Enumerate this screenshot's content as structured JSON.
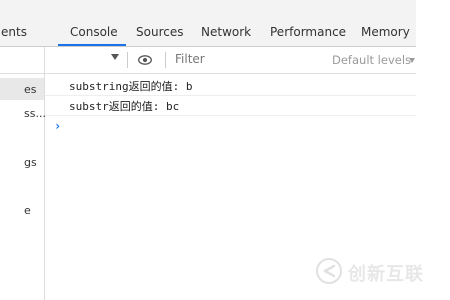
{
  "tabs": [
    {
      "label": "ents"
    },
    {
      "label": "Console"
    },
    {
      "label": "Sources"
    },
    {
      "label": "Network"
    },
    {
      "label": "Performance"
    },
    {
      "label": "Memory"
    }
  ],
  "active_tab": "Console",
  "toolbar": {
    "filter_placeholder": "Filter",
    "levels_label": "Default levels"
  },
  "sidebar": {
    "items": [
      {
        "label": "es"
      },
      {
        "label": "ss..."
      },
      {
        "label": "gs"
      },
      {
        "label": "e"
      }
    ]
  },
  "console": {
    "messages": [
      {
        "text": "substring返回的值: b"
      },
      {
        "text": "substr返回的值: bc"
      }
    ],
    "prompt": "›"
  },
  "watermark": {
    "text": "创新互联"
  },
  "colors": {
    "accent": "#1a73e8",
    "tabbar_bg": "#f3f3f3"
  }
}
